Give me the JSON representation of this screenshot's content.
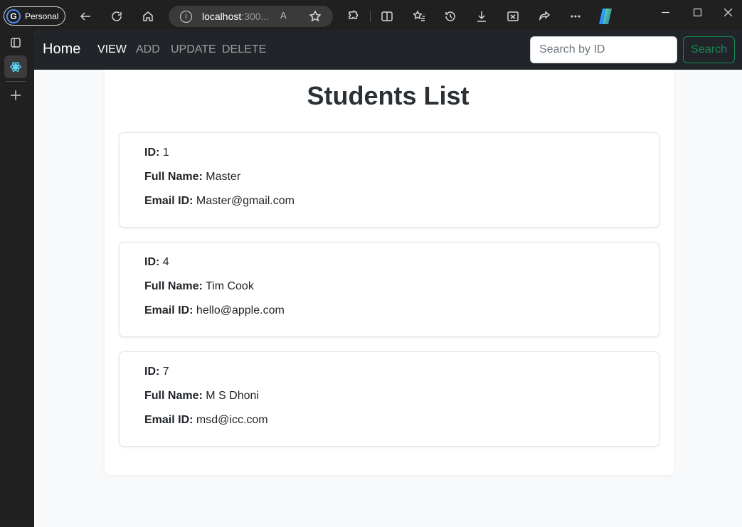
{
  "browser": {
    "profile_label": "Personal",
    "profile_initial": "G",
    "address_host": "localhost",
    "address_rest": ":300...",
    "read_aloud": "A"
  },
  "navbar": {
    "brand": "Home",
    "links": [
      {
        "label": "VIEW",
        "active": true
      },
      {
        "label": "ADD",
        "active": false
      },
      {
        "label": "UPDATE",
        "active": false
      },
      {
        "label": "DELETE",
        "active": false
      }
    ],
    "search_placeholder": "Search by ID",
    "search_button": "Search"
  },
  "page": {
    "title": "Students List",
    "id_label": "ID:",
    "name_label": "Full Name:",
    "email_label": "Email ID:"
  },
  "students": [
    {
      "id": "1",
      "full_name": "Master",
      "email": "Master@gmail.com"
    },
    {
      "id": "4",
      "full_name": "Tim Cook",
      "email": "hello@apple.com"
    },
    {
      "id": "7",
      "full_name": "M S Dhoni",
      "email": "msd@icc.com"
    }
  ],
  "colors": {
    "navbar_bg": "#212529",
    "search_button": "#198754",
    "page_bg": "#f8f9fa"
  }
}
